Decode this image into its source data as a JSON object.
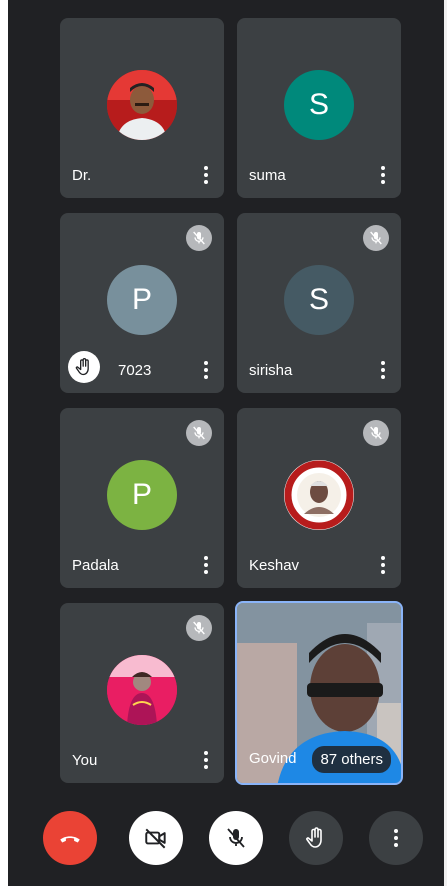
{
  "tiles": [
    {
      "name": "Dr.",
      "avatar": "photo",
      "muted": false
    },
    {
      "name": "suma",
      "avatar_letter": "S",
      "avatar_color": "#00897b",
      "muted": false
    },
    {
      "name": "7023",
      "avatar_letter": "P",
      "avatar_color": "#78909c",
      "muted": true,
      "hand_raised": true
    },
    {
      "name": "sirisha",
      "avatar_letter": "S",
      "avatar_color": "#455a64",
      "muted": true
    },
    {
      "name": "Padala",
      "avatar_letter": "P",
      "avatar_color": "#7cb342",
      "muted": true
    },
    {
      "name": "Keshav",
      "avatar": "emblem",
      "muted": true
    },
    {
      "name": "You",
      "avatar": "photo",
      "muted": true
    },
    {
      "name": "Govind",
      "avatar": "video",
      "others_label": "87 others",
      "active_speaker": true
    }
  ],
  "controls": {
    "leave_color": "#ea4335",
    "icons": [
      "phone-hangup-icon",
      "camera-off-icon",
      "mic-off-icon",
      "raise-hand-icon",
      "more-vert-icon"
    ]
  },
  "colors": {
    "background": "#202124",
    "tile": "#3c4043",
    "active_border": "#8ab4f8"
  }
}
